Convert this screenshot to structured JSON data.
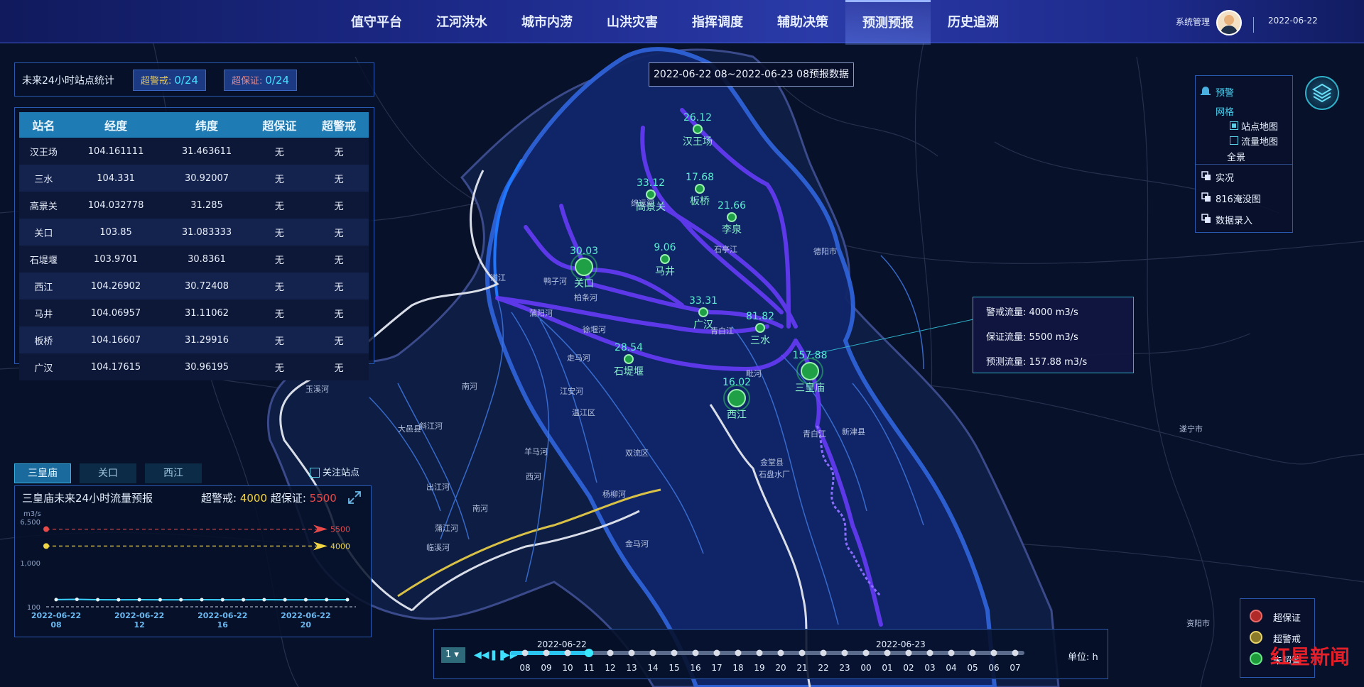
{
  "header": {
    "nav": [
      "值守平台",
      "江河洪水",
      "城市内涝",
      "山洪灾害",
      "指挥调度",
      "辅助决策",
      "预测预报",
      "历史追溯"
    ],
    "active_index": 6,
    "user": "系统管理",
    "date": "2022-06-22"
  },
  "stats": {
    "title": "未来24小时站点统计",
    "warn_label": "超警戒:",
    "warn_value": "0/24",
    "guard_label": "超保证:",
    "guard_value": "0/24"
  },
  "table": {
    "headers": [
      "站名",
      "经度",
      "纬度",
      "超保证",
      "超警戒"
    ],
    "rows": [
      [
        "汉王场",
        "104.161111",
        "31.463611",
        "无",
        "无"
      ],
      [
        "三水",
        "104.331",
        "30.92007",
        "无",
        "无"
      ],
      [
        "高景关",
        "104.032778",
        "31.285",
        "无",
        "无"
      ],
      [
        "关口",
        "103.85",
        "31.083333",
        "无",
        "无"
      ],
      [
        "石堤堰",
        "103.9701",
        "30.8361",
        "无",
        "无"
      ],
      [
        "西江",
        "104.26902",
        "30.72408",
        "无",
        "无"
      ],
      [
        "马井",
        "104.06957",
        "31.11062",
        "无",
        "无"
      ],
      [
        "板桥",
        "104.16607",
        "31.29916",
        "无",
        "无"
      ],
      [
        "广汉",
        "104.17615",
        "30.96195",
        "无",
        "无"
      ]
    ]
  },
  "date_range": "2022-06-22 08~2022-06-23 08预报数据",
  "map": {
    "stations": [
      {
        "name": "汉王场",
        "value": "26.12"
      },
      {
        "name": "高景关",
        "value": "33.12"
      },
      {
        "name": "板桥",
        "value": "17.68"
      },
      {
        "name": "李泉",
        "value": "21.66"
      },
      {
        "name": "关口",
        "value": "30.03"
      },
      {
        "name": "马井",
        "value": "9.06"
      },
      {
        "name": "广汉",
        "value": "33.31"
      },
      {
        "name": "三水",
        "value": "81.82"
      },
      {
        "name": "石堤堰",
        "value": "28.54"
      },
      {
        "name": "三皇庙",
        "value": "157.88"
      },
      {
        "name": "西江",
        "value": "16.02"
      }
    ],
    "labels": [
      "德阳市",
      "新津县",
      "遂宁市",
      "资阳市",
      "青白江",
      "金堂县",
      "石盘水厂",
      "温江区",
      "双流区",
      "大邑县",
      "南河",
      "斜江河",
      "徐堰河",
      "柏条河",
      "走马河",
      "江安河",
      "羊马河",
      "西河",
      "杨柳河",
      "金马河",
      "毗河",
      "青白江",
      "绵远河",
      "石亭江",
      "鸭子河",
      "湔江",
      "蒲阳河",
      "玉溪河",
      "出江河",
      "临溪河",
      "蒲江河",
      "南河"
    ]
  },
  "tooltip": {
    "warn": "警戒流量:  4000 m3/s",
    "guard": "保证流量:  5500 m3/s",
    "forecast": "预测流量:  157.88 m3/s"
  },
  "station_tabs": [
    "三皇庙",
    "关口",
    "西江"
  ],
  "focus_label": "关注站点",
  "flow_panel": {
    "title": "三皇庙未来24小时流量预报",
    "warn_label": "超警戒:",
    "warn_value": "4000",
    "guard_label": "超保证:",
    "guard_value": "5500"
  },
  "chart_data": {
    "type": "line",
    "title": "三皇庙未来24小时流量预报",
    "ylabel": "m3/s",
    "y_ticks": [
      "6,500",
      "1,000",
      "100"
    ],
    "ylim": [
      100,
      6500
    ],
    "x": [
      "08",
      "09",
      "10",
      "11",
      "12",
      "13",
      "14",
      "15",
      "16",
      "17",
      "18",
      "19",
      "20",
      "21",
      "22"
    ],
    "x_tick_labels": [
      [
        "2022-06-22",
        "08"
      ],
      [
        "2022-06-22",
        "12"
      ],
      [
        "2022-06-22",
        "16"
      ],
      [
        "2022-06-22",
        "20"
      ]
    ],
    "series": [
      {
        "values": [
          160,
          165,
          158,
          157,
          158,
          157,
          157,
          158,
          157,
          157,
          158,
          157,
          157,
          158,
          158
        ]
      }
    ],
    "thresholds": [
      {
        "label": "5500",
        "value": 5500,
        "color": "#e84a4a"
      },
      {
        "label": "4000",
        "value": 4000,
        "color": "#f2d544"
      }
    ]
  },
  "layers": {
    "title": "预警",
    "grid": "网格",
    "station_map": "站点地图",
    "flow_map": "流量地图",
    "overview": "全景",
    "items": [
      "实况",
      "816淹没图",
      "数据录入"
    ]
  },
  "legend": [
    "超保证",
    "超警戒",
    "未超警"
  ],
  "timeline": {
    "select": "1",
    "date_start": "2022-06-22",
    "date_end": "2022-06-23",
    "hours": [
      "08",
      "09",
      "10",
      "11",
      "12",
      "13",
      "14",
      "15",
      "16",
      "17",
      "18",
      "19",
      "20",
      "21",
      "22",
      "23",
      "00",
      "01",
      "02",
      "03",
      "04",
      "05",
      "06",
      "07"
    ],
    "current_index": 3,
    "unit": "单位: h"
  },
  "watermark": {
    "a": "红",
    "b": "星新闻"
  }
}
